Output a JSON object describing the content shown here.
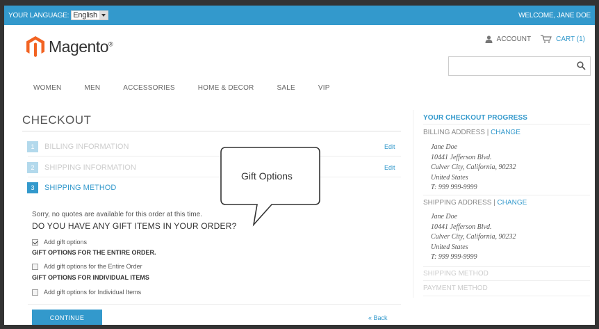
{
  "topbar": {
    "language_label": "YOUR LANGUAGE:",
    "language_value": "English",
    "welcome": "WELCOME, JANE DOE"
  },
  "header": {
    "logo_text": "Magento",
    "logo_mark": "®",
    "account_label": "ACCOUNT",
    "cart_label": "CART (1)",
    "search_placeholder": ""
  },
  "nav": {
    "items": [
      "WOMEN",
      "MEN",
      "ACCESSORIES",
      "HOME & DECOR",
      "SALE",
      "VIP"
    ]
  },
  "checkout": {
    "title": "CHECKOUT",
    "steps": [
      {
        "number": "1",
        "label": "BILLING INFORMATION",
        "edit": "Edit"
      },
      {
        "number": "2",
        "label": "SHIPPING INFORMATION",
        "edit": "Edit"
      },
      {
        "number": "3",
        "label": "SHIPPING METHOD",
        "edit": ""
      }
    ],
    "message": "Sorry, no quotes are available for this order at this time.",
    "question": "DO YOU HAVE ANY GIFT ITEMS IN YOUR ORDER?",
    "options": {
      "add_gift_options": "Add gift options",
      "entire_order_heading": "GIFT OPTIONS FOR THE ENTIRE ORDER.",
      "entire_order_option": "Add gift options for the Entire Order",
      "individual_heading": "GIFT OPTIONS FOR INDIVIDUAL ITEMS",
      "individual_option": "Add gift options for Individual Items"
    },
    "continue_label": "CONTINUE",
    "back_label": "« Back"
  },
  "callout": {
    "text": "Gift Options"
  },
  "progress": {
    "title": "YOUR CHECKOUT PROGRESS",
    "billing_heading": "BILLING ADDRESS",
    "shipping_heading": "SHIPPING ADDRESS",
    "separator": " | ",
    "change_label": "CHANGE",
    "billing_address": [
      "Jane Doe",
      "10441 Jefferson Blvd.",
      "Culver City, California, 90232",
      "United States",
      "T: 999 999-9999"
    ],
    "shipping_address": [
      "Jane Doe",
      "10441 Jefferson Blvd.",
      "Culver City, California, 90232",
      "United States",
      "T: 999 999-9999"
    ],
    "shipping_method": "SHIPPING METHOD",
    "payment_method": "PAYMENT METHOD"
  },
  "colors": {
    "accent": "#3399cc",
    "logo_orange": "#f26322"
  },
  "icons": {
    "account": "person-icon",
    "cart": "cart-icon",
    "search": "search-icon",
    "dropdown": "chevron-down-icon"
  }
}
